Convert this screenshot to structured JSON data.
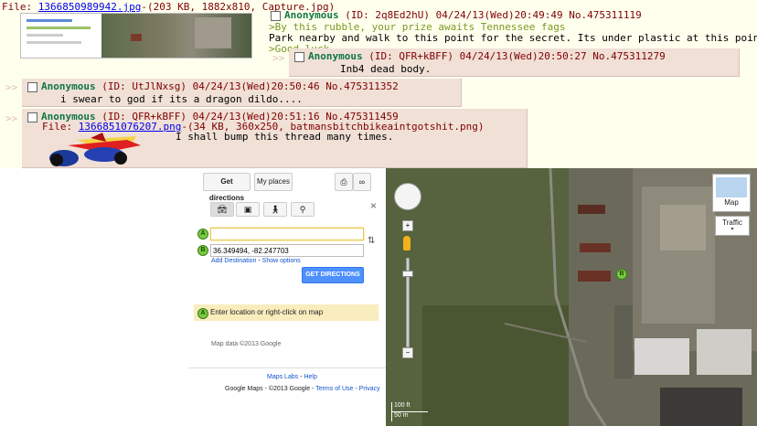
{
  "post_top": {
    "file_label": "File:",
    "file_name": "1366850989942.jpg",
    "file_info": "-(203 KB, 1882x810, Capture.jpg)",
    "name": "Anonymous",
    "meta": "(ID: 2q8Ed2hU) 04/24/13(Wed)20:49:49",
    "post_no": "No.475311119",
    "lines": [
      ">By this rubble, your prize awaits Tennessee fags",
      "Park nearby and walk to this point for the secret. Its under plastic at this point",
      ">Good luck"
    ]
  },
  "reply1": {
    "name": "Anonymous",
    "meta": "(ID: QFR+kBFF) 04/24/13(Wed)20:50:27",
    "post_no": "No.475311279",
    "text": "Inb4 dead body."
  },
  "reply2": {
    "arrows": ">>",
    "name": "Anonymous",
    "meta": "(ID: UtJlNxsg) 04/24/13(Wed)20:50:46",
    "post_no": "No.475311352",
    "text": "i swear to god if its a dragon dildo...."
  },
  "reply3": {
    "arrows": ">>",
    "name": "Anonymous",
    "meta": "(ID: QFR+kBFF) 04/24/13(Wed)20:51:16",
    "post_no": "No.475311459",
    "file_label": "File:",
    "file_name": "1366851076207.png",
    "file_info": "-(34 KB, 360x250, batmansbitchbikeaintgotshit.png)",
    "text": "I shall bump this thread many times."
  },
  "maps": {
    "get_directions": "Get directions",
    "my_places": "My places",
    "close": "×",
    "input_a_value": "",
    "marker_a": "A",
    "marker_b": "B",
    "input_b_value": "36.349494, -82.247703",
    "add_destination": "Add Destination",
    "separator": " - ",
    "show_options": "Show options",
    "get_directions_btn": "GET DIRECTIONS",
    "hint": "Enter location or right-click on map",
    "map_data": "Map data ©2013 Google",
    "maps_labs": "Maps Labs",
    "help": "Help",
    "footer_prefix": "Google Maps - ©2013 Google - ",
    "terms": "Terms of Use",
    "privacy": "Privacy",
    "layer_map": "Map",
    "layer_traffic": "Traffic",
    "scale_ft": "100 ft",
    "scale_m": "50 m",
    "zoom_plus": "+",
    "zoom_minus": "−"
  },
  "colors": {
    "board_bg": "#ffffee",
    "reply_bg": "#f0e0d6",
    "name_green": "#117743",
    "text_maroon": "#800000",
    "quote_green": "#789922",
    "maps_button_blue": "#4d90fe",
    "hint_yellow": "#f9edbe"
  }
}
